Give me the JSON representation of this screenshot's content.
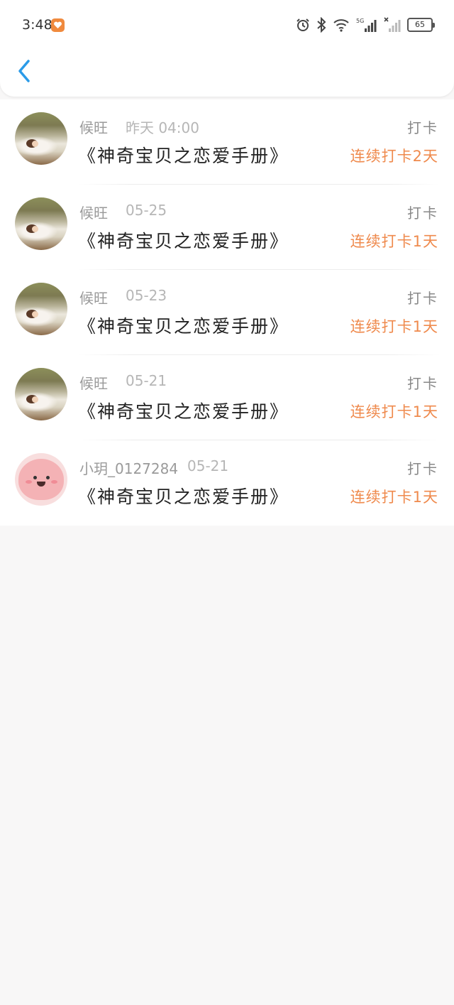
{
  "status_bar": {
    "time": "3:48",
    "battery": "65",
    "network": "5G"
  },
  "header": {
    "back_icon": "chevron-left-icon"
  },
  "checkins": [
    {
      "user": "候旺",
      "time": "昨天 04:00",
      "title": "《神奇宝贝之恋爱手册》",
      "action": "打卡",
      "streak": "连续打卡2天",
      "avatar": "photo"
    },
    {
      "user": "候旺",
      "time": "05-25",
      "title": "《神奇宝贝之恋爱手册》",
      "action": "打卡",
      "streak": "连续打卡1天",
      "avatar": "photo"
    },
    {
      "user": "候旺",
      "time": "05-23",
      "title": "《神奇宝贝之恋爱手册》",
      "action": "打卡",
      "streak": "连续打卡1天",
      "avatar": "photo"
    },
    {
      "user": "候旺",
      "time": "05-21",
      "title": "《神奇宝贝之恋爱手册》",
      "action": "打卡",
      "streak": "连续打卡1天",
      "avatar": "photo"
    },
    {
      "user": "小玥_0127284",
      "time": "05-21",
      "title": "《神奇宝贝之恋爱手册》",
      "action": "打卡",
      "streak": "连续打卡1天",
      "avatar": "cute"
    }
  ],
  "colors": {
    "accent_blue": "#2b9be8",
    "streak_orange": "#ef8a4d",
    "background": "#f8f7f7"
  }
}
